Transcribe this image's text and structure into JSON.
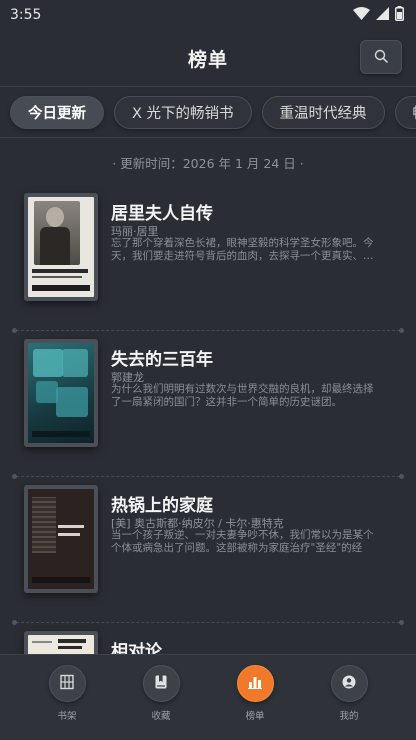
{
  "status_bar": {
    "time": "3:55",
    "icons": [
      "wifi-icon",
      "cellular-icon",
      "battery-icon"
    ]
  },
  "header": {
    "title": "榜单",
    "search_icon": "search-icon"
  },
  "tabs": [
    {
      "label": "今日更新",
      "active": true
    },
    {
      "label": "X 光下的畅销书",
      "active": false
    },
    {
      "label": "重温时代经典",
      "active": false
    },
    {
      "label": "畅",
      "active": false
    }
  ],
  "update_time": "· 更新时间：2026 年 1 月 24 日 ·",
  "books": [
    {
      "title": "居里夫人自传",
      "author": "玛丽·居里",
      "description": "忘了那个穿着深色长裙，眼神坚毅的科学圣女形象吧。今天，我们要走进符号背后的血肉，去探寻一个更真实、…",
      "cover_text": "居里夫人自传",
      "cover_color": "#e9e6df"
    },
    {
      "title": "失去的三百年",
      "author": "郭建龙",
      "description": "为什么我们明明有过数次与世界交融的良机，却最终选择了一扇紧闭的国门？这并非一个简单的历史谜团。",
      "cover_text": "失去的三百年",
      "cover_color": "#1f4750"
    },
    {
      "title": "热锅上的家庭",
      "author": "[美] 奥古斯都·纳皮尔 / 卡尔·惠特克",
      "description": "当一个孩子叛逆、一对夫妻争吵不休，我们常以为是某个个体或病急出了问题。这部被称为家庭治疗\"圣经\"的经典…",
      "cover_text": "热锅上的家庭",
      "cover_color": "#2b2322"
    },
    {
      "title": "相对论",
      "author": "",
      "description": "",
      "cover_text": "相对论",
      "cover_color": "#ece8de"
    }
  ],
  "bottom_nav": [
    {
      "label": "书架",
      "icon": "bookshelf-icon",
      "active": false
    },
    {
      "label": "收藏",
      "icon": "bookmark-icon",
      "active": false
    },
    {
      "label": "榜单",
      "icon": "ranking-icon",
      "active": true
    },
    {
      "label": "我的",
      "icon": "user-icon",
      "active": false
    }
  ],
  "colors": {
    "background": "#2a2d33",
    "accent": "#f07a2a",
    "text_primary": "#f4f4f4",
    "text_secondary": "#8f949b"
  }
}
